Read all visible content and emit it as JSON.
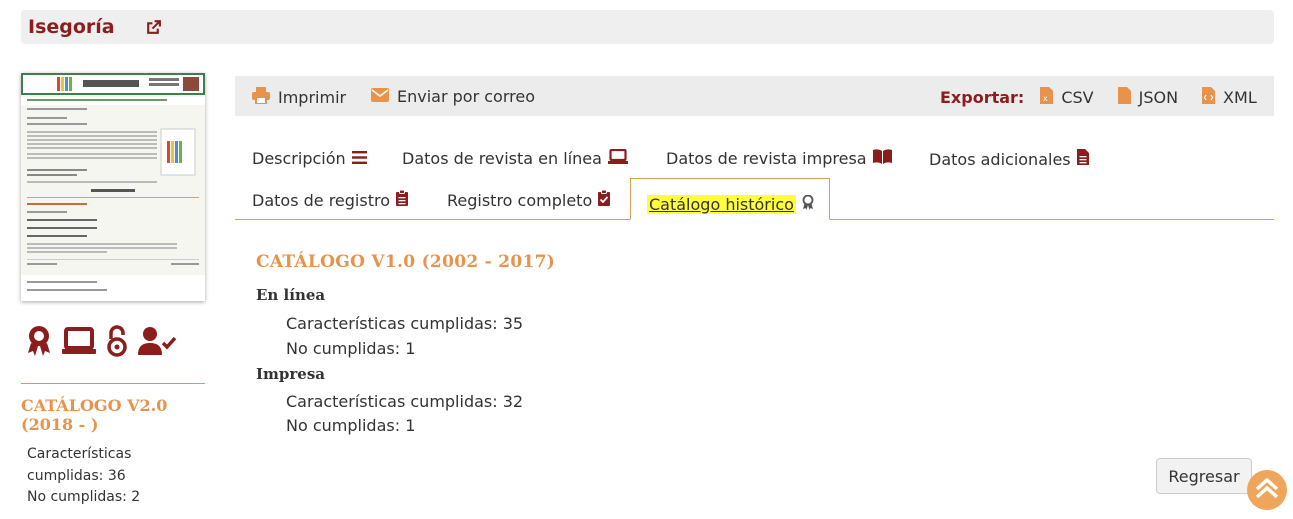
{
  "journal": {
    "title": "Isegoría"
  },
  "badges": [
    "award-icon",
    "laptop-icon",
    "open-access-icon",
    "user-check-icon"
  ],
  "sidebar": {
    "catalog_title": "CATÁLOGO V2.0 (2018 - )",
    "met_label": "Características cumplidas:",
    "met_value": "36",
    "unmet_label": "No cumplidas:",
    "unmet_value": "2"
  },
  "toolbar": {
    "print": "Imprimir",
    "email": "Enviar por correo",
    "export_label": "Exportar:",
    "csv": "CSV",
    "json": "JSON",
    "xml": "XML"
  },
  "tabs": [
    {
      "label": "Descripción"
    },
    {
      "label": "Datos de revista en línea"
    },
    {
      "label": "Datos de revista impresa"
    },
    {
      "label": "Datos adicionales"
    },
    {
      "label": "Datos de registro"
    },
    {
      "label": "Registro completo"
    },
    {
      "label": "Catálogo histórico",
      "active": true
    }
  ],
  "main": {
    "catalog_title": "CATÁLOGO V1.0 (2002 - 2017)",
    "online": {
      "heading": "En línea",
      "met_label": "Características cumplidas:",
      "met_value": "35",
      "unmet_label": "No cumplidas:",
      "unmet_value": "1"
    },
    "print": {
      "heading": "Impresa",
      "met_label": "Características cumplidas:",
      "met_value": "32",
      "unmet_label": "No cumplidas:",
      "unmet_value": "1"
    }
  },
  "back_button": "Regresar",
  "colors": {
    "brand": "#8b1d1d",
    "accent": "#e8924c",
    "highlight": "#ffff3d"
  }
}
